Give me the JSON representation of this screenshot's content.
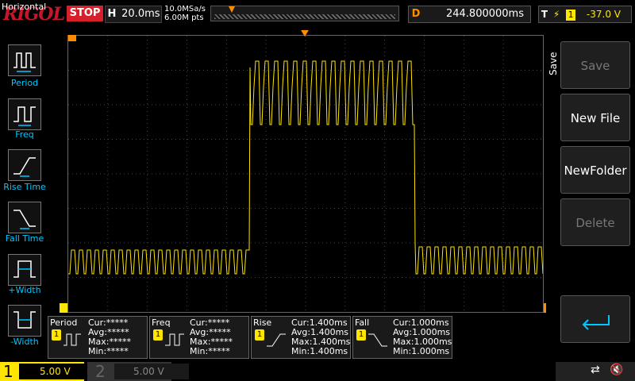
{
  "brand": "RIGOL",
  "status": "STOP",
  "timebase": {
    "label": "H",
    "value": "20.0ms"
  },
  "sampling": {
    "rate": "10.0MSa/s",
    "points": "6.00M pts"
  },
  "delay": {
    "label": "D",
    "value": "244.800000ms"
  },
  "trigger": {
    "label": "T",
    "channel": "1",
    "level": "-37.0 V"
  },
  "left_menu": {
    "title": "Horizontal",
    "items": [
      {
        "label": "Period",
        "icon": "period-icon"
      },
      {
        "label": "Freq",
        "icon": "freq-icon"
      },
      {
        "label": "Rise Time",
        "icon": "rise-time-icon"
      },
      {
        "label": "Fall Time",
        "icon": "fall-time-icon"
      },
      {
        "label": "+Width",
        "icon": "pos-width-icon"
      },
      {
        "label": "-Width",
        "icon": "neg-width-icon"
      }
    ]
  },
  "right_menu": {
    "tab": "Save",
    "buttons": [
      {
        "label": "Save",
        "enabled": false
      },
      {
        "label": "New File",
        "enabled": true
      },
      {
        "label": "NewFolder",
        "enabled": true
      },
      {
        "label": "Delete",
        "enabled": false
      }
    ]
  },
  "measurements": [
    {
      "name": "Period",
      "channel": "1",
      "cur": "Cur:*****",
      "avg": "Avg:*****",
      "max": "Max:*****",
      "min": "Min:*****"
    },
    {
      "name": "Freq",
      "channel": "1",
      "cur": "Cur:*****",
      "avg": "Avg:*****",
      "max": "Max:*****",
      "min": "Min:*****"
    },
    {
      "name": "Rise",
      "channel": "1",
      "cur": "Cur:1.400ms",
      "avg": "Avg:1.400ms",
      "max": "Max:1.400ms",
      "min": "Min:1.400ms"
    },
    {
      "name": "Fall",
      "channel": "1",
      "cur": "Cur:1.000ms",
      "avg": "Avg:1.000ms",
      "max": "Max:1.000ms",
      "min": "Min:1.000ms"
    }
  ],
  "channels": [
    {
      "number": "1",
      "scale": "5.00 V",
      "active": true
    },
    {
      "number": "2",
      "scale": "5.00 V",
      "active": false
    }
  ],
  "colors": {
    "ch1": "#ffe500",
    "accent": "#ff8c00",
    "stop": "#d8202a",
    "menu_label": "#00c8ff"
  }
}
